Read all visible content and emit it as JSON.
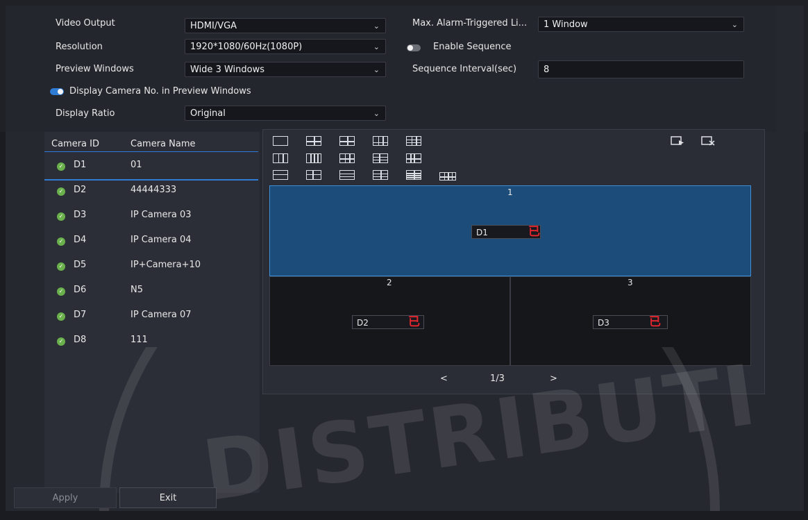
{
  "settings": {
    "video_output": {
      "label": "Video Output",
      "value": "HDMI/VGA"
    },
    "resolution": {
      "label": "Resolution",
      "value": "1920*1080/60Hz(1080P)"
    },
    "preview_windows": {
      "label": "Preview Windows",
      "value": "Wide 3 Windows"
    },
    "display_camera_no": {
      "label": "Display Camera No. in Preview Windows",
      "enabled": true
    },
    "display_ratio": {
      "label": "Display Ratio",
      "value": "Original"
    },
    "max_alarm": {
      "label": "Max. Alarm-Triggered Li...",
      "value": "1 Window"
    },
    "enable_sequence": {
      "label": "Enable Sequence",
      "enabled": false
    },
    "sequence_interval": {
      "label": "Sequence Interval(sec)",
      "value": "8"
    }
  },
  "camera_list": {
    "headers": {
      "id": "Camera ID",
      "name": "Camera Name"
    },
    "rows": [
      {
        "id": "D1",
        "name": "01"
      },
      {
        "id": "D2",
        "name": "44444333"
      },
      {
        "id": "D3",
        "name": "IP Camera 03"
      },
      {
        "id": "D4",
        "name": "IP Camera 04"
      },
      {
        "id": "D5",
        "name": "IP+Camera+10"
      },
      {
        "id": "D6",
        "name": "N5"
      },
      {
        "id": "D7",
        "name": "IP Camera 07"
      },
      {
        "id": "D8",
        "name": "111"
      }
    ]
  },
  "preview": {
    "windows": [
      {
        "number": "1",
        "camera": "D1"
      },
      {
        "number": "2",
        "camera": "D2"
      },
      {
        "number": "3",
        "camera": "D3"
      }
    ],
    "pager": {
      "prev": "<",
      "page": "1/3",
      "next": ">"
    }
  },
  "footer": {
    "apply_label": "Apply",
    "exit_label": "Exit"
  },
  "icons": {
    "chevron": "chevron-down-icon",
    "check": "check-circle-icon",
    "trash": "trash-icon",
    "play_seq": "sequence-play-icon",
    "clear_seq": "sequence-clear-icon"
  },
  "watermark": "DISTRIBUTI",
  "colors": {
    "accent": "#2f7cd6",
    "selected_window": "#1c4d7a",
    "trash": "#e0252f",
    "check": "#6ab04c"
  }
}
